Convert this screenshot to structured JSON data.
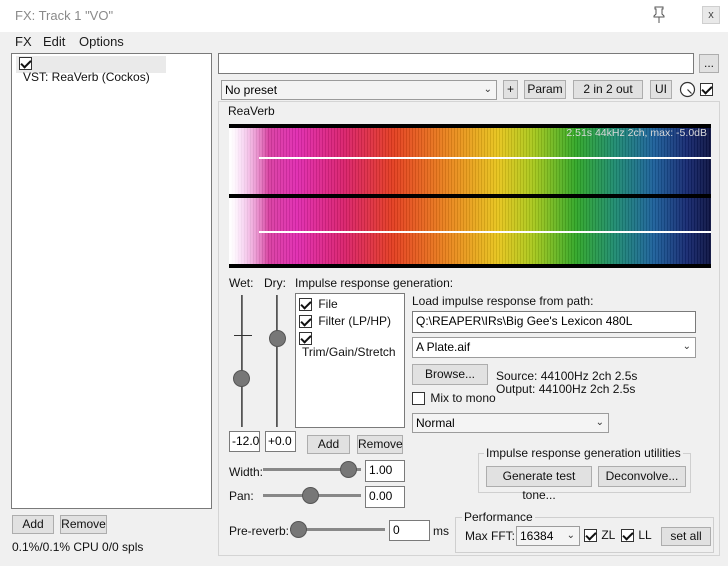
{
  "window": {
    "title": "FX: Track 1 \"VO\"",
    "close": "x"
  },
  "menu": [
    "FX",
    "Edit",
    "Options"
  ],
  "fx_list": {
    "items": [
      {
        "label": "VST: ReaVerb (Cockos)",
        "enabled": true
      }
    ]
  },
  "left_buttons": {
    "add": "Add",
    "remove": "Remove"
  },
  "status": "0.1%/0.1% CPU 0/0 spls",
  "plugin": {
    "ellipsis": "...",
    "preset": "No preset",
    "plus": "+",
    "param": "Param",
    "io": "2 in 2 out",
    "ui": "UI",
    "name": "ReaVerb"
  },
  "spectrogram": {
    "info": "2.51s 44kHz 2ch, max: -5.0dB"
  },
  "wet": {
    "label": "Wet:",
    "value": "-12.0",
    "level": 0.35
  },
  "dry": {
    "label": "Dry:",
    "value": "+0.0",
    "level": 0.7
  },
  "ir_gen": {
    "label": "Impulse response generation:",
    "items": [
      {
        "label": "File",
        "checked": true
      },
      {
        "label": "Filter (LP/HP)",
        "checked": true
      },
      {
        "label": "Trim/Gain/Stretch",
        "checked": true
      }
    ],
    "add": "Add",
    "remove": "Remove"
  },
  "file": {
    "path_label": "Load impulse response from path:",
    "path": "Q:\\REAPER\\IRs\\Big Gee's Lexicon 480L",
    "file": "A Plate.aif",
    "browse": "Browse...",
    "source": "Source: 44100Hz 2ch 2.5s",
    "output": "Output: 44100Hz 2ch 2.5s",
    "mix_mono": "Mix to mono",
    "mix_mono_checked": false,
    "mode": "Normal"
  },
  "utilities": {
    "label": "Impulse response generation utilities",
    "generate": "Generate test tone...",
    "deconvolve": "Deconvolve..."
  },
  "width": {
    "label": "Width:",
    "value": "1.00"
  },
  "pan": {
    "label": "Pan:",
    "value": "0.00"
  },
  "prereverb": {
    "label": "Pre-reverb:",
    "value": "0",
    "unit": "ms"
  },
  "performance": {
    "label": "Performance",
    "fft_label": "Max FFT:",
    "fft": "16384",
    "zl": "ZL",
    "zl_checked": true,
    "ll": "LL",
    "ll_checked": true,
    "set_all": "set all"
  },
  "colors": {
    "accent": "#000000",
    "panel": "#f0f0f0"
  }
}
